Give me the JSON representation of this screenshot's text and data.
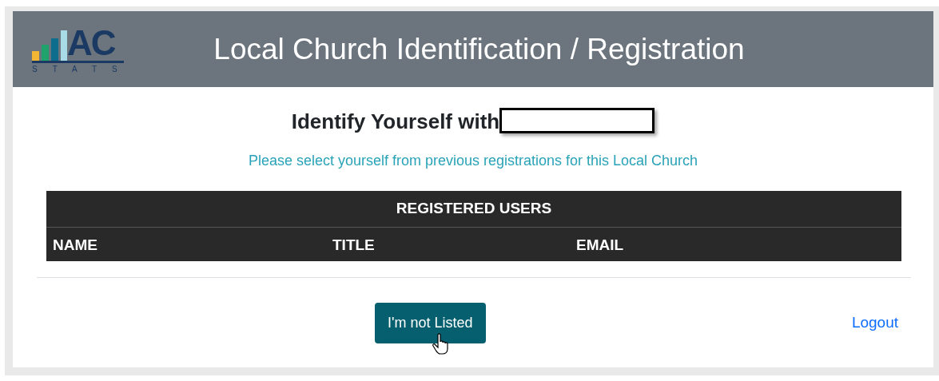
{
  "logo": {
    "text": "AC",
    "subtitle": "STATS"
  },
  "header": {
    "title": "Local Church Identification / Registration"
  },
  "heading": {
    "text": "Identify Yourself with",
    "redacted": true
  },
  "instruction": "Please select yourself from previous registrations for this Local Church",
  "table": {
    "title": "REGISTERED USERS",
    "columns": [
      "NAME",
      "TITLE",
      "EMAIL"
    ]
  },
  "buttons": [
    {
      "label": "I'm not Listed",
      "kind": "primary"
    },
    {
      "label": "Logout",
      "kind": "link"
    }
  ]
}
